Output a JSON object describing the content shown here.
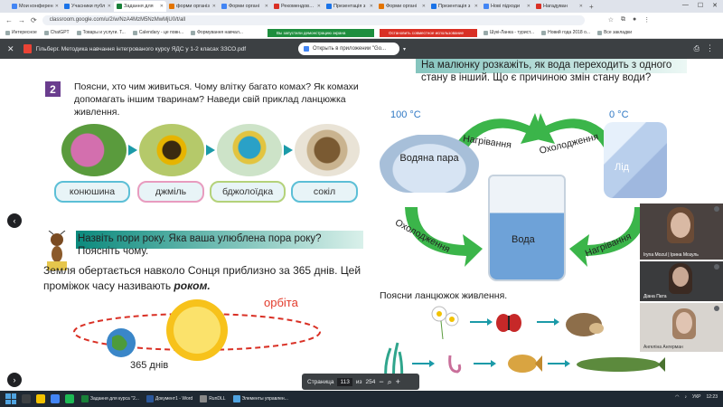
{
  "tabs": [
    {
      "label": "Мои конферен",
      "color": "#4285f4",
      "active": false
    },
    {
      "label": "Учасники публ",
      "color": "#1a73e8",
      "active": false
    },
    {
      "label": "Задання для",
      "color": "#188038",
      "active": true
    },
    {
      "label": "форми організ",
      "color": "#e37400",
      "active": false
    },
    {
      "label": "Форми органі",
      "color": "#4285f4",
      "active": false
    },
    {
      "label": "Рекомендовані",
      "color": "#d93025",
      "active": false
    },
    {
      "label": "Презентація з",
      "color": "#1a73e8",
      "active": false
    },
    {
      "label": "Форми органі",
      "color": "#e37400",
      "active": false
    },
    {
      "label": "Презентація з",
      "color": "#1a73e8",
      "active": false
    },
    {
      "label": "Нові підходи",
      "color": "#4285f4",
      "active": false
    },
    {
      "label": "Нагадуван",
      "color": "#d93025",
      "active": false
    }
  ],
  "browser": {
    "url": "classroom.google.com/u/2/w/NzA4MzM5NzMwMjU0/t/all",
    "new_tab": "+",
    "back": "←",
    "forward": "→",
    "reload": "⟳"
  },
  "bookmarks": [
    "Интересное",
    "ChatGPT",
    "Товары и услуги. Т...",
    "Calendary - це повн...",
    "Формування навчал...",
    "Шукі-Ланка - турист...",
    "Новий года 2018 о...",
    "Все закладки"
  ],
  "banners": {
    "green": "Вы запустили демонстрацию экрана",
    "red": "Остановить совместное использование"
  },
  "pdf": {
    "title": "Гільберг. Методика навчання інтегрованого курсу ЯДС у 1-2 класах ЗЗСО.pdf",
    "open_with": "Открыть в приложении \"Go...",
    "page_label": "Страница",
    "page_current": "113",
    "page_of": "из",
    "page_total": "254",
    "zoom_out": "−",
    "zoom_in": "+"
  },
  "left_page": {
    "task_number": "2",
    "question": "Поясни, хто чим живиться. Чому влітку багато комах? Як комахи допомагать іншим тваринам? Наведи свій приклад ланцюжка живлення.",
    "chain_labels": [
      "конюшина",
      "джміль",
      "бджолоїдка",
      "сокіл"
    ],
    "seasons_q": "Назвіть пори року. Яка ваша улюблена пора року? Поясніть чому.",
    "earth_text_before": "Земля обертається навколо Сонця приблизно за 365 днів. Цей проміжок часу називають ",
    "earth_text_bold": "роком.",
    "orbit_label": "орбіта",
    "days_label": "365 днів"
  },
  "right_page": {
    "question": "На малюнку розкажіть, як вода переходить з одного стану в інший. Що є причиною змін стану води?",
    "temp_hot": "100 °С",
    "temp_cold": "0 °С",
    "cloud_label": "Водяна пара",
    "ice_label": "Лід",
    "water_label": "Вода",
    "heating": "Нагрівання",
    "cooling": "Охолодження",
    "chain_q": "Поясни ланцюжок живлення."
  },
  "participants": [
    {
      "name": "Iryna Mozul | Ірина Мозуль"
    },
    {
      "name": "Діана Пата"
    },
    {
      "name": "Ангеліна Ангерман"
    }
  ],
  "taskbar": {
    "apps": [
      {
        "label": "Задання для курса \"2...",
        "color": "#188038"
      },
      {
        "label": "Документ1 - Word",
        "color": "#2b579a"
      },
      {
        "label": "RunDLL",
        "color": "#888888"
      },
      {
        "label": "Элементы управлен...",
        "color": "#4fa3e0"
      }
    ],
    "lang": "УКР",
    "time": "12:23"
  }
}
